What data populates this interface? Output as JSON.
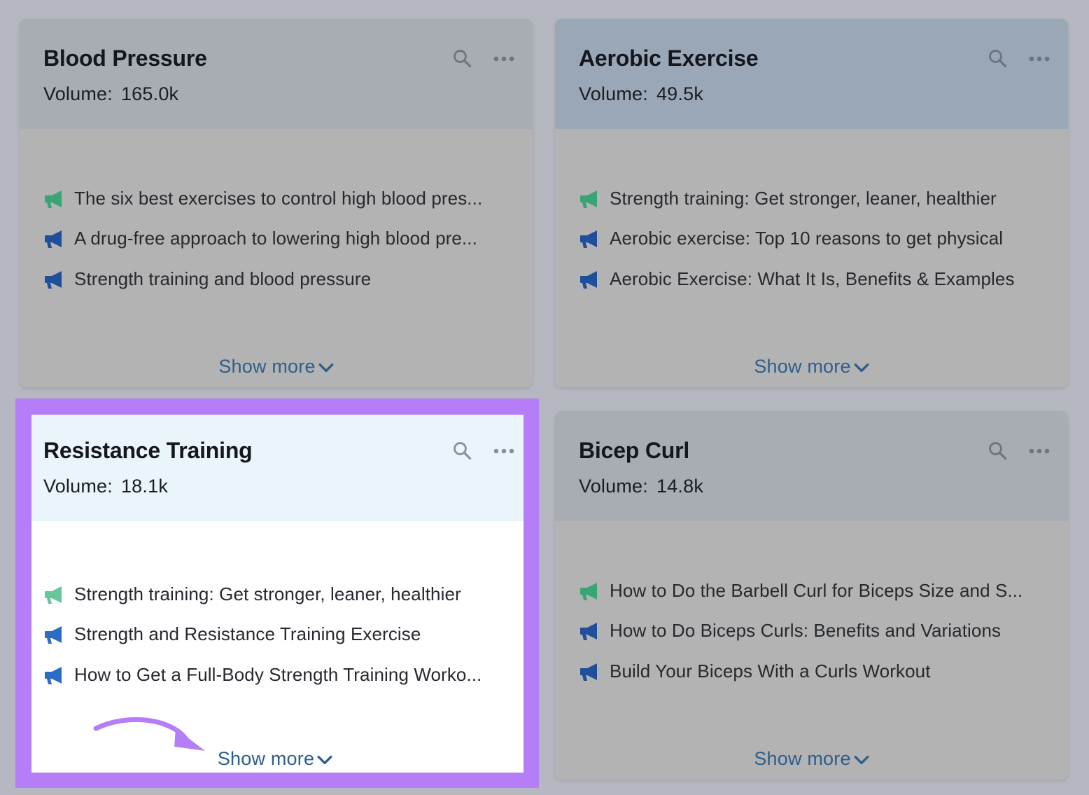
{
  "colors": {
    "highlight": "#b57ef8",
    "link": "#2d5e8c",
    "organic_icon": "#3aa574",
    "paid_icon": "#1f4e9a"
  },
  "cards": [
    {
      "title": "Blood Pressure",
      "volume_label": "Volume:",
      "volume_value": "165.0k",
      "results": [
        {
          "icon": "megaphone-green-icon",
          "text": "The six best exercises to control high blood pres..."
        },
        {
          "icon": "megaphone-blue-icon",
          "text": "A drug-free approach to lowering high blood pre..."
        },
        {
          "icon": "megaphone-blue-icon",
          "text": "Strength training and blood pressure"
        }
      ],
      "show_more": "Show more"
    },
    {
      "title": "Aerobic Exercise",
      "volume_label": "Volume:",
      "volume_value": "49.5k",
      "results": [
        {
          "icon": "megaphone-green-icon",
          "text": "Strength training: Get stronger, leaner, healthier"
        },
        {
          "icon": "megaphone-blue-icon",
          "text": "Aerobic exercise: Top 10 reasons to get physical"
        },
        {
          "icon": "megaphone-blue-icon",
          "text": "Aerobic Exercise: What It Is, Benefits & Examples"
        }
      ],
      "show_more": "Show more"
    },
    {
      "title": "Resistance Training",
      "volume_label": "Volume:",
      "volume_value": "18.1k",
      "results": [
        {
          "icon": "megaphone-green-icon",
          "text": "Strength training: Get stronger, leaner, healthier"
        },
        {
          "icon": "megaphone-blue-icon",
          "text": "Strength and Resistance Training Exercise"
        },
        {
          "icon": "megaphone-blue-icon",
          "text": "How to Get a Full-Body Strength Training Worko..."
        }
      ],
      "show_more": "Show more"
    },
    {
      "title": "Bicep Curl",
      "volume_label": "Volume:",
      "volume_value": "14.8k",
      "results": [
        {
          "icon": "megaphone-green-icon",
          "text": "How to Do the Barbell Curl for Biceps Size and S..."
        },
        {
          "icon": "megaphone-blue-icon",
          "text": "How to Do Biceps Curls: Benefits and Variations"
        },
        {
          "icon": "megaphone-blue-icon",
          "text": "Build Your Biceps With a Curls Workout"
        }
      ],
      "show_more": "Show more"
    }
  ]
}
